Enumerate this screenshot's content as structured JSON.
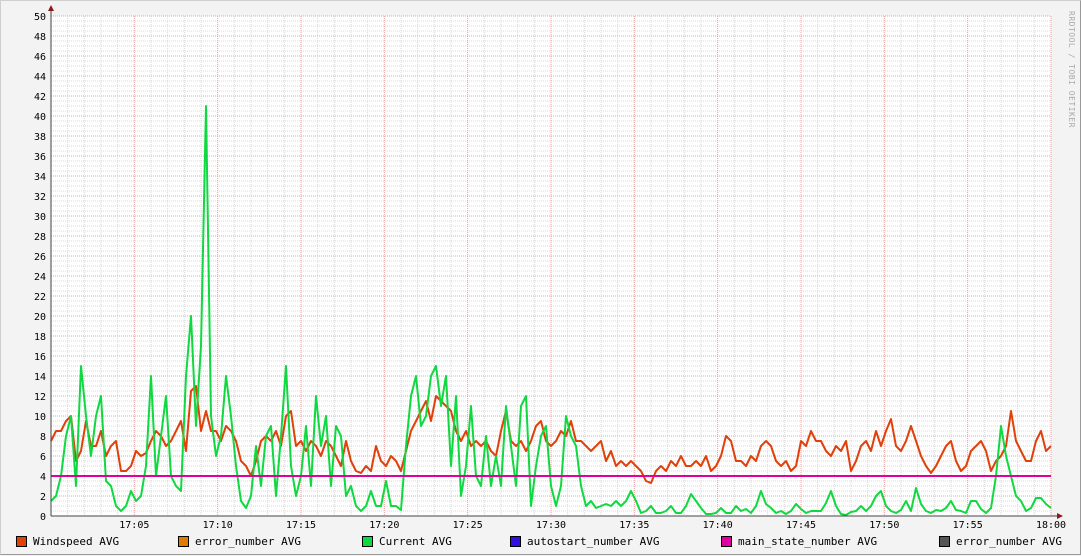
{
  "watermark": "RRDTOOL / TOBI OETIKER",
  "chart_data": {
    "type": "line",
    "title": "",
    "xlabel": "",
    "ylabel": "",
    "x_range": [
      "17:00",
      "18:00"
    ],
    "sample_interval_seconds": 18,
    "ylim": [
      0,
      50
    ],
    "grid": true,
    "y_ticks": [
      "0",
      "2",
      "4",
      "6",
      "8",
      "10",
      "12",
      "14",
      "16",
      "18",
      "20",
      "22",
      "24",
      "26",
      "28",
      "30",
      "32",
      "34",
      "36",
      "38",
      "40",
      "42",
      "44",
      "46",
      "48",
      "50"
    ],
    "x_ticks": [
      "17:05",
      "17:10",
      "17:15",
      "17:20",
      "17:25",
      "17:30",
      "17:35",
      "17:40",
      "17:45",
      "17:50",
      "17:55",
      "18:00"
    ],
    "legend_placement": "bottom",
    "legend": [
      {
        "label": "Windspeed AVG",
        "color": "#e0400a"
      },
      {
        "label": "error_number AVG",
        "color": "#e07a00"
      },
      {
        "label": "Current AVG",
        "color": "#10d840"
      },
      {
        "label": "autostart_number AVG",
        "color": "#3010e0"
      },
      {
        "label": "main_state_number AVG",
        "color": "#e000a0"
      },
      {
        "label": "error_number AVG",
        "color": "#555555"
      }
    ],
    "series": [
      {
        "name": "Windspeed AVG",
        "color": "#e0400a",
        "values": [
          7.5,
          8.5,
          8.5,
          9.5,
          10,
          5.5,
          6.5,
          9.5,
          7,
          7,
          8.5,
          6,
          7,
          7.5,
          4.5,
          4.5,
          5,
          6.5,
          6,
          6.3,
          7.5,
          8.5,
          8,
          7,
          7.5,
          8.5,
          9.5,
          6.5,
          12.5,
          13,
          8.5,
          10.5,
          8.5,
          8.5,
          7.5,
          9,
          8.5,
          7.5,
          5.5,
          5,
          4,
          5.5,
          7.5,
          8,
          7.5,
          8.5,
          7,
          10,
          10.5,
          7,
          7.5,
          6.5,
          7.5,
          7,
          6,
          7.5,
          7,
          6,
          5,
          7.5,
          5.5,
          4.5,
          4.3,
          5,
          4.5,
          7,
          5.5,
          5,
          6,
          5.5,
          4.5,
          6.5,
          8.5,
          9.5,
          10.5,
          11.5,
          9.5,
          12,
          11.5,
          11,
          10.5,
          8.5,
          7.5,
          8.5,
          7,
          7.5,
          7,
          7.5,
          6.5,
          6,
          8.5,
          10.5,
          7.5,
          7,
          7.5,
          6.5,
          7.5,
          9,
          9.5,
          7.5,
          7,
          7.5,
          8.5,
          8,
          9.5,
          7.5,
          7.5,
          7,
          6.5,
          7,
          7.5,
          5.5,
          6.5,
          5,
          5.5,
          5,
          5.5,
          5,
          4.5,
          3.5,
          3.3,
          4.5,
          5,
          4.5,
          5.5,
          5,
          6,
          5,
          5,
          5.5,
          5,
          6,
          4.5,
          5,
          6,
          8,
          7.5,
          5.5,
          5.5,
          5,
          6,
          5.5,
          7,
          7.5,
          7,
          5.5,
          5,
          5.5,
          4.5,
          5,
          7.5,
          7,
          8.5,
          7.5,
          7.5,
          6.5,
          6,
          7,
          6.5,
          7.5,
          4.5,
          5.5,
          7,
          7.5,
          6.5,
          8.5,
          7,
          8.5,
          9.7,
          7,
          6.5,
          7.5,
          9,
          7.5,
          6,
          5,
          4.3,
          5,
          6,
          7,
          7.5,
          5.5,
          4.5,
          5,
          6.5,
          7,
          7.5,
          6.5,
          4.5,
          5.5,
          6,
          7,
          10.5,
          7.5,
          6.5,
          5.5,
          5.5,
          7.5,
          8.5,
          6.5,
          7
        ]
      },
      {
        "name": "error_number AVG",
        "color": "#e07a00",
        "values": []
      },
      {
        "name": "Current AVG",
        "color": "#10d840",
        "values": [
          1.5,
          2,
          4,
          8,
          10,
          3,
          15,
          10,
          6,
          10,
          12,
          3.5,
          3,
          1,
          0.5,
          1,
          2.5,
          1.5,
          2,
          5,
          14,
          4,
          8,
          12,
          4,
          3,
          2.5,
          14,
          20,
          9,
          17,
          41,
          10,
          6,
          8,
          14,
          10,
          5,
          1.5,
          0.8,
          2,
          7,
          3,
          8,
          9,
          2,
          8,
          15,
          5,
          2,
          4,
          9,
          3,
          12,
          7,
          10,
          3,
          9,
          8,
          2,
          3,
          1,
          0.5,
          1,
          2.5,
          1,
          1,
          3.5,
          1,
          1,
          0.6,
          7,
          12,
          14,
          9,
          10,
          14,
          15,
          11,
          14,
          5,
          12,
          2,
          5,
          11,
          4,
          3,
          8,
          3,
          6,
          3,
          11,
          7,
          3,
          11,
          12,
          1,
          5,
          8,
          9,
          3,
          1,
          3,
          10,
          8,
          7,
          3,
          1,
          1.5,
          0.8,
          1,
          1.2,
          1,
          1.5,
          1,
          1.5,
          2.5,
          1.5,
          0.3,
          0.5,
          1,
          0.3,
          0.3,
          0.5,
          1,
          0.3,
          0.3,
          1,
          2.2,
          1.5,
          0.8,
          0.2,
          0.2,
          0.3,
          0.8,
          0.3,
          0.3,
          1,
          0.5,
          0.7,
          0.3,
          1,
          2.5,
          1.2,
          0.8,
          0.3,
          0.5,
          0.2,
          0.5,
          1.2,
          0.7,
          0.3,
          0.5,
          0.5,
          0.5,
          1.3,
          2.5,
          1,
          0.2,
          0.1,
          0.4,
          0.5,
          1,
          0.5,
          1,
          2,
          2.5,
          1,
          0.5,
          0.3,
          0.6,
          1.5,
          0.5,
          2.8,
          1.2,
          0.5,
          0.3,
          0.6,
          0.5,
          0.8,
          1.5,
          0.6,
          0.5,
          0.3,
          1.5,
          1.5,
          0.7,
          0.3,
          0.8,
          4,
          9,
          6,
          4,
          2,
          1.5,
          0.5,
          0.8,
          1.8,
          1.8,
          1.2,
          0.8
        ]
      },
      {
        "name": "autostart_number AVG",
        "color": "#3010e0",
        "values": []
      },
      {
        "name": "main_state_number AVG",
        "color": "#e000a0",
        "constant": 4
      },
      {
        "name": "error_number AVG",
        "color": "#555555",
        "values": []
      }
    ]
  }
}
